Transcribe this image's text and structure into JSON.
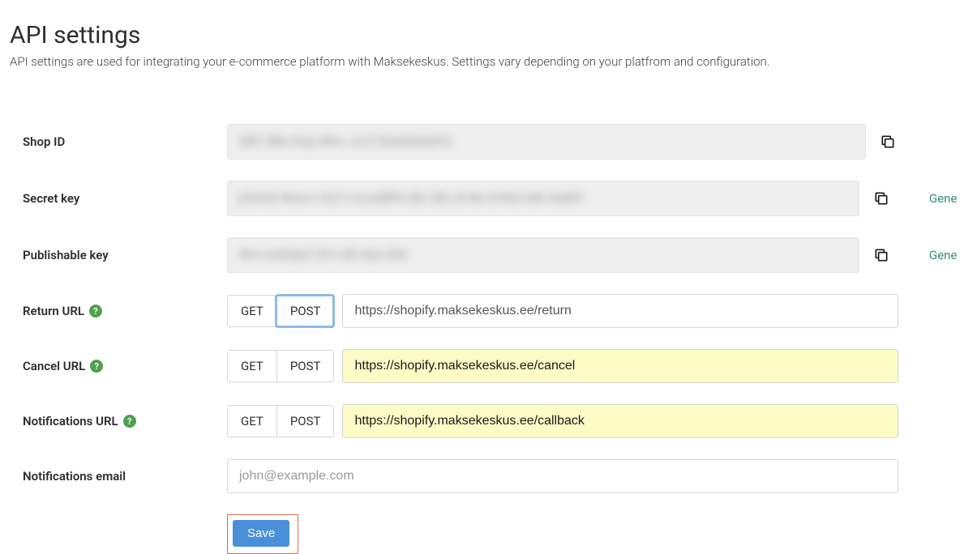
{
  "header": {
    "title": "API settings",
    "subtitle": "API settings are used for integrating your e-commerce platform with Maksekeskus. Settings vary depending on your platfrom and configuration."
  },
  "labels": {
    "shop_id": "Shop ID",
    "secret_key": "Secret key",
    "publishable_key": "Publishable key",
    "return_url": "Return URL",
    "cancel_url": "Cancel URL",
    "notifications_url": "Notifications URL",
    "notifications_email": "Notifications email"
  },
  "blurred": {
    "shop_id": "fd01 8lkn Kng  eWo~ oi (1 East0aQni01)",
    "secret_key": "jClmnE Wnnc+ HuT ri nLaQllFk iGlc 50L iO-Nn d+Wnl eWi HuD01",
    "publishable_key": "Wm moEnkp7 (¥ h nEl eQo Gh0"
  },
  "method": {
    "get": "GET",
    "post": "POST"
  },
  "urls": {
    "return": "https://shopify.maksekeskus.ee/return",
    "cancel": "https://shopify.maksekeskus.ee/cancel",
    "notifications": "https://shopify.maksekeskus.ee/callback"
  },
  "email_placeholder": "john@example.com",
  "actions": {
    "generate": "Gene",
    "save": "Save"
  }
}
